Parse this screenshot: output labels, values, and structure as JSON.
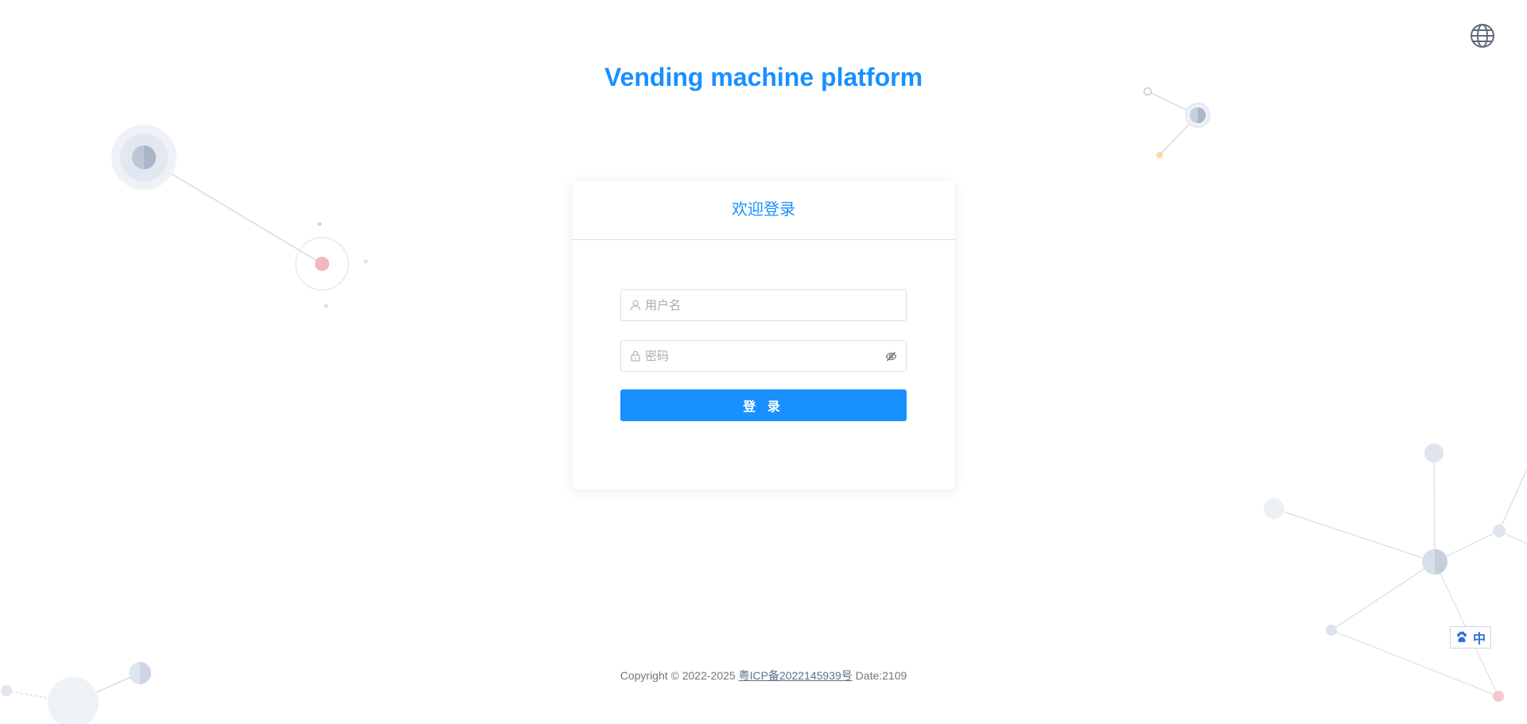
{
  "header": {
    "title": "Vending machine platform",
    "language_icon": "globe-icon"
  },
  "login": {
    "heading": "欢迎登录",
    "username": {
      "placeholder": "用户名",
      "value": "",
      "icon": "user-icon"
    },
    "password": {
      "placeholder": "密码",
      "value": "",
      "icon": "lock-icon",
      "toggle_icon": "eye-off-icon"
    },
    "submit_label": "登 录"
  },
  "footer": {
    "copyright": "Copyright © 2022-2025",
    "icp_link": "粤ICP备2022145939号",
    "date": "Date:2109"
  },
  "ime": {
    "icon": "paw-icon",
    "label": "中"
  },
  "colors": {
    "accent": "#1890ff",
    "border": "#dcdfe6",
    "placeholder": "#a8abb2",
    "footer_text": "#73767a"
  }
}
